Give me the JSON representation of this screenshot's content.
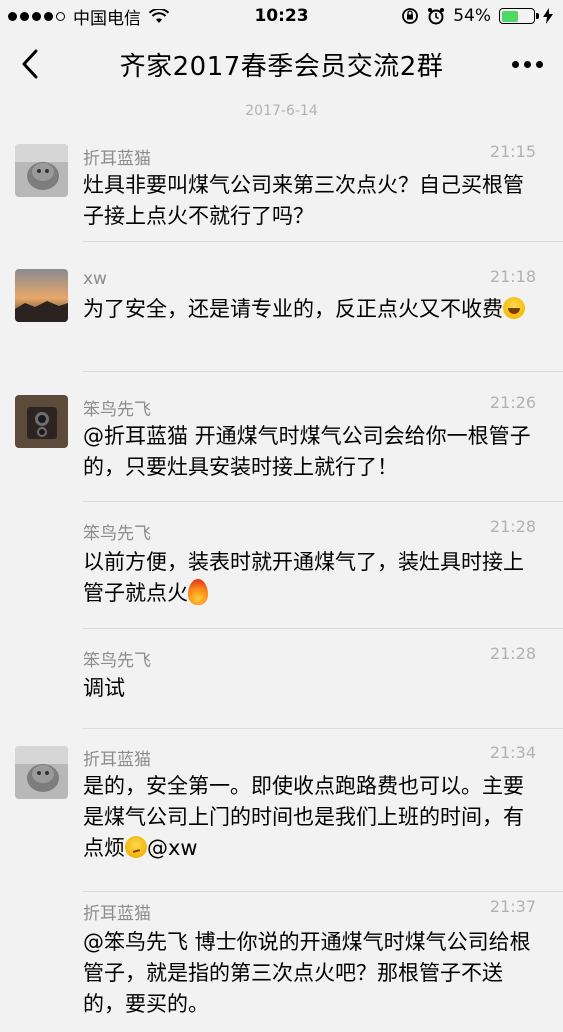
{
  "status_bar": {
    "carrier": "中国电信",
    "time": "10:23",
    "battery": "54%",
    "battery_level": 0.54,
    "signal_icon": "signal-dots-icon",
    "wifi_icon": "wifi-icon"
  },
  "nav": {
    "title": "齐家2017春季会员交流2群",
    "back_icon": "chevron-left-icon",
    "more_icon": "more-dots-icon"
  },
  "date_separator": "2017-6-14",
  "colors": {
    "background": "#f2f2f2",
    "meta_gray": "#8c8c8c",
    "battery_green": "#4cd964"
  },
  "messages": [
    {
      "sender": "折耳蓝猫",
      "time": "21:15",
      "text": "灶具非要叫煤气公司来第三次点火？自己买根管子接上点火不就行了吗？",
      "avatar": "cat-avatar"
    },
    {
      "sender": "xw",
      "time": "21:18",
      "text": "为了安全，还是请专业的，反正点火又不收费",
      "emoji": "laughing-emoji",
      "avatar": "sunset-avatar"
    },
    {
      "sender": "笨鸟先飞",
      "time": "21:26",
      "text": "@折耳蓝猫 开通煤气时煤气公司会给你一根管子的，只要灶具安装时接上就行了！",
      "avatar": "camera-avatar"
    },
    {
      "sender": "笨鸟先飞",
      "time": "21:28",
      "text": "以前方便，装表时就开通煤气了，装灶具时接上管子就点火",
      "emoji": "fire-emoji"
    },
    {
      "sender": "笨鸟先飞",
      "time": "21:28",
      "text": "调试"
    },
    {
      "sender": "折耳蓝猫",
      "time": "21:34",
      "text_before": "是的，安全第一。即使收点跑路费也可以。主要是煤气公司上门的时间也是我们上班的时间，有点烦",
      "emoji": "thinking-emoji",
      "text_after": "@xw",
      "avatar": "cat-avatar"
    },
    {
      "sender": "折耳蓝猫",
      "time": "21:37",
      "text": "@笨鸟先飞 博士你说的开通煤气时煤气公司给根管子，就是指的第三次点火吧？那根管子不送的，要买的。"
    }
  ]
}
